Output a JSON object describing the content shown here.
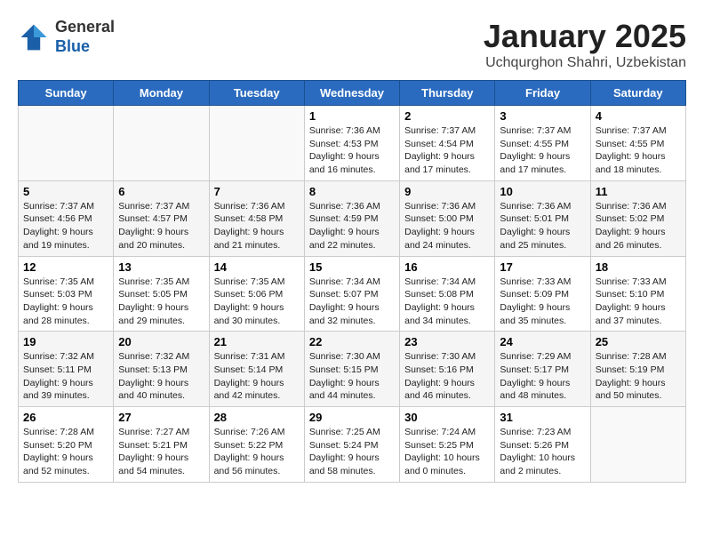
{
  "header": {
    "logo_line1": "General",
    "logo_line2": "Blue",
    "month": "January 2025",
    "location": "Uchqurghon Shahri, Uzbekistan"
  },
  "days_of_week": [
    "Sunday",
    "Monday",
    "Tuesday",
    "Wednesday",
    "Thursday",
    "Friday",
    "Saturday"
  ],
  "weeks": [
    [
      {
        "day": "",
        "info": ""
      },
      {
        "day": "",
        "info": ""
      },
      {
        "day": "",
        "info": ""
      },
      {
        "day": "1",
        "sunrise": "7:36 AM",
        "sunset": "4:53 PM",
        "daylight": "9 hours and 16 minutes."
      },
      {
        "day": "2",
        "sunrise": "7:37 AM",
        "sunset": "4:54 PM",
        "daylight": "9 hours and 17 minutes."
      },
      {
        "day": "3",
        "sunrise": "7:37 AM",
        "sunset": "4:55 PM",
        "daylight": "9 hours and 17 minutes."
      },
      {
        "day": "4",
        "sunrise": "7:37 AM",
        "sunset": "4:55 PM",
        "daylight": "9 hours and 18 minutes."
      }
    ],
    [
      {
        "day": "5",
        "sunrise": "7:37 AM",
        "sunset": "4:56 PM",
        "daylight": "9 hours and 19 minutes."
      },
      {
        "day": "6",
        "sunrise": "7:37 AM",
        "sunset": "4:57 PM",
        "daylight": "9 hours and 20 minutes."
      },
      {
        "day": "7",
        "sunrise": "7:36 AM",
        "sunset": "4:58 PM",
        "daylight": "9 hours and 21 minutes."
      },
      {
        "day": "8",
        "sunrise": "7:36 AM",
        "sunset": "4:59 PM",
        "daylight": "9 hours and 22 minutes."
      },
      {
        "day": "9",
        "sunrise": "7:36 AM",
        "sunset": "5:00 PM",
        "daylight": "9 hours and 24 minutes."
      },
      {
        "day": "10",
        "sunrise": "7:36 AM",
        "sunset": "5:01 PM",
        "daylight": "9 hours and 25 minutes."
      },
      {
        "day": "11",
        "sunrise": "7:36 AM",
        "sunset": "5:02 PM",
        "daylight": "9 hours and 26 minutes."
      }
    ],
    [
      {
        "day": "12",
        "sunrise": "7:35 AM",
        "sunset": "5:03 PM",
        "daylight": "9 hours and 28 minutes."
      },
      {
        "day": "13",
        "sunrise": "7:35 AM",
        "sunset": "5:05 PM",
        "daylight": "9 hours and 29 minutes."
      },
      {
        "day": "14",
        "sunrise": "7:35 AM",
        "sunset": "5:06 PM",
        "daylight": "9 hours and 30 minutes."
      },
      {
        "day": "15",
        "sunrise": "7:34 AM",
        "sunset": "5:07 PM",
        "daylight": "9 hours and 32 minutes."
      },
      {
        "day": "16",
        "sunrise": "7:34 AM",
        "sunset": "5:08 PM",
        "daylight": "9 hours and 34 minutes."
      },
      {
        "day": "17",
        "sunrise": "7:33 AM",
        "sunset": "5:09 PM",
        "daylight": "9 hours and 35 minutes."
      },
      {
        "day": "18",
        "sunrise": "7:33 AM",
        "sunset": "5:10 PM",
        "daylight": "9 hours and 37 minutes."
      }
    ],
    [
      {
        "day": "19",
        "sunrise": "7:32 AM",
        "sunset": "5:11 PM",
        "daylight": "9 hours and 39 minutes."
      },
      {
        "day": "20",
        "sunrise": "7:32 AM",
        "sunset": "5:13 PM",
        "daylight": "9 hours and 40 minutes."
      },
      {
        "day": "21",
        "sunrise": "7:31 AM",
        "sunset": "5:14 PM",
        "daylight": "9 hours and 42 minutes."
      },
      {
        "day": "22",
        "sunrise": "7:30 AM",
        "sunset": "5:15 PM",
        "daylight": "9 hours and 44 minutes."
      },
      {
        "day": "23",
        "sunrise": "7:30 AM",
        "sunset": "5:16 PM",
        "daylight": "9 hours and 46 minutes."
      },
      {
        "day": "24",
        "sunrise": "7:29 AM",
        "sunset": "5:17 PM",
        "daylight": "9 hours and 48 minutes."
      },
      {
        "day": "25",
        "sunrise": "7:28 AM",
        "sunset": "5:19 PM",
        "daylight": "9 hours and 50 minutes."
      }
    ],
    [
      {
        "day": "26",
        "sunrise": "7:28 AM",
        "sunset": "5:20 PM",
        "daylight": "9 hours and 52 minutes."
      },
      {
        "day": "27",
        "sunrise": "7:27 AM",
        "sunset": "5:21 PM",
        "daylight": "9 hours and 54 minutes."
      },
      {
        "day": "28",
        "sunrise": "7:26 AM",
        "sunset": "5:22 PM",
        "daylight": "9 hours and 56 minutes."
      },
      {
        "day": "29",
        "sunrise": "7:25 AM",
        "sunset": "5:24 PM",
        "daylight": "9 hours and 58 minutes."
      },
      {
        "day": "30",
        "sunrise": "7:24 AM",
        "sunset": "5:25 PM",
        "daylight": "10 hours and 0 minutes."
      },
      {
        "day": "31",
        "sunrise": "7:23 AM",
        "sunset": "5:26 PM",
        "daylight": "10 hours and 2 minutes."
      },
      {
        "day": "",
        "info": ""
      }
    ]
  ]
}
